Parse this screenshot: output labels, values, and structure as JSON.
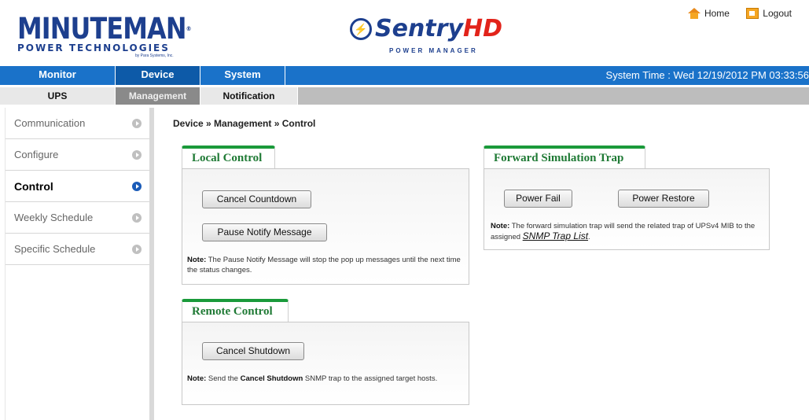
{
  "header": {
    "logo_left": {
      "main": "MINUTEMAN",
      "reg": "®",
      "sub": "POWER TECHNOLOGIES",
      "tiny": "by Para Systems, Inc."
    },
    "logo_center": {
      "part1": "Sentry",
      "part2": "HD",
      "sub": "POWER MANAGER"
    },
    "home_label": "Home",
    "logout_label": "Logout"
  },
  "nav_primary": {
    "items": [
      {
        "label": "Monitor"
      },
      {
        "label": "Device"
      },
      {
        "label": "System"
      }
    ],
    "active": "Device",
    "system_time": "System Time : Wed 12/19/2012 PM 03:33:56"
  },
  "nav_secondary": {
    "items": [
      {
        "label": "UPS"
      },
      {
        "label": "Management"
      },
      {
        "label": "Notification"
      }
    ],
    "active": "Management"
  },
  "sidebar": {
    "items": [
      {
        "label": "Communication"
      },
      {
        "label": "Configure"
      },
      {
        "label": "Control"
      },
      {
        "label": "Weekly Schedule"
      },
      {
        "label": "Specific Schedule"
      }
    ],
    "active": "Control"
  },
  "breadcrumb": "Device » Management » Control",
  "local_control": {
    "title": "Local Control",
    "cancel_countdown_label": "Cancel Countdown",
    "pause_notify_label": "Pause Notify Message",
    "note_prefix": "Note:",
    "note_text": " The Pause Notify Message will stop the pop up messages until the next time the status changes."
  },
  "remote_control": {
    "title": "Remote Control",
    "cancel_shutdown_label": "Cancel Shutdown",
    "note_prefix": "Note:",
    "note_text_1": " Send the ",
    "note_bold": "Cancel Shutdown",
    "note_text_2": " SNMP trap to the assigned target hosts."
  },
  "forward_trap": {
    "title": "Forward Simulation Trap",
    "power_fail_label": "Power Fail",
    "power_restore_label": "Power Restore",
    "note_prefix": "Note:",
    "note_text": " The forward simulation trap will send the related trap of UPSv4 MIB to the assigned ",
    "note_link": "SNMP Trap List",
    "note_end": "."
  },
  "colors": {
    "nav_blue": "#1a72c9",
    "panel_green": "#1a9a3a",
    "brand_blue": "#1d3f8e",
    "brand_red": "#e2231a"
  }
}
